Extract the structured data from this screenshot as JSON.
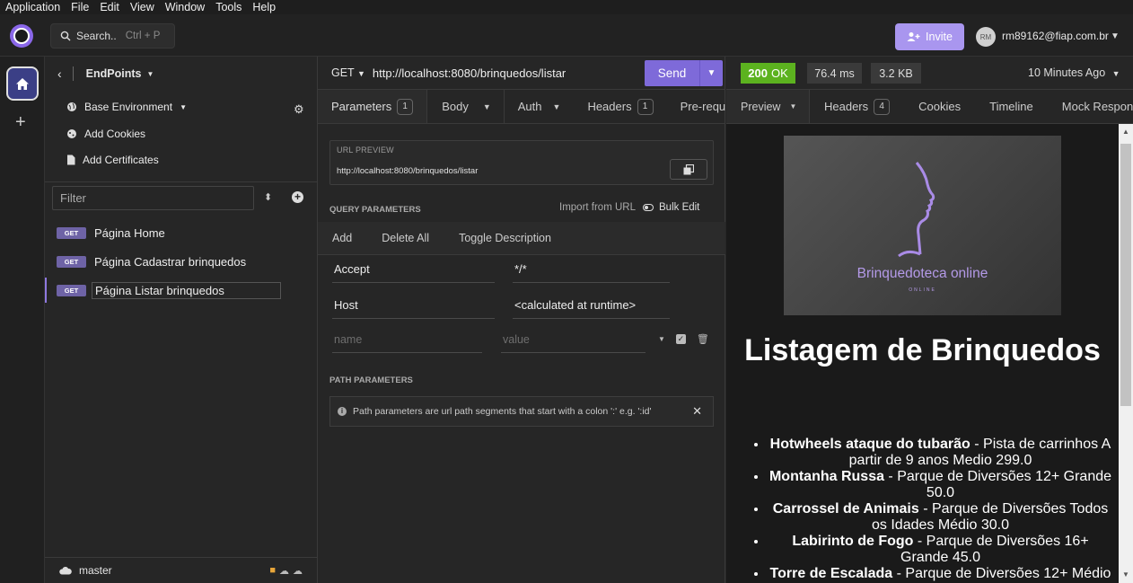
{
  "menu": [
    "Application",
    "File",
    "Edit",
    "View",
    "Window",
    "Tools",
    "Help"
  ],
  "topbar": {
    "search_label": "Search..",
    "search_shortcut": "Ctrl + P",
    "invite_label": "Invite",
    "avatar_initials": "RM",
    "account_email": "rm89162@fiap.com.br"
  },
  "sidebar": {
    "project_name": "EndPoints",
    "environment": "Base Environment",
    "add_cookies": "Add Cookies",
    "add_certificates": "Add Certificates",
    "filter_placeholder": "Filter",
    "requests": [
      {
        "method": "GET",
        "name": "Página Home"
      },
      {
        "method": "GET",
        "name": "Página Cadastrar brinquedos"
      },
      {
        "method": "GET",
        "name": "Página Listar brinquedos"
      }
    ],
    "branch": "master"
  },
  "request": {
    "method": "GET",
    "url": "http://localhost:8080/brinquedos/listar",
    "send_label": "Send",
    "tabs": [
      {
        "label": "Parameters",
        "badge": "1"
      },
      {
        "label": "Body"
      },
      {
        "label": "Auth"
      },
      {
        "label": "Headers",
        "badge": "1"
      },
      {
        "label": "Pre-requ"
      }
    ],
    "url_preview_title": "URL PREVIEW",
    "url_preview_value": "http://localhost:8080/brinquedos/listar",
    "query_title": "QUERY PARAMETERS",
    "import_from_url": "Import from URL",
    "bulk_edit": "Bulk Edit",
    "actions": [
      "Add",
      "Delete All",
      "Toggle Description"
    ],
    "params": [
      {
        "name": "Accept",
        "value": "*/*"
      },
      {
        "name": "Host",
        "value": "<calculated at runtime>"
      }
    ],
    "name_placeholder": "name",
    "value_placeholder": "value",
    "path_title": "PATH PARAMETERS",
    "path_info": "Path parameters are url path segments that start with a colon ':' e.g. ':id'"
  },
  "response": {
    "status_code": "200",
    "status_text": "OK",
    "time": "76.4 ms",
    "size": "3.2 KB",
    "when": "10 Minutes Ago",
    "tabs": [
      {
        "label": "Preview"
      },
      {
        "label": "Headers",
        "badge": "4"
      },
      {
        "label": "Cookies"
      },
      {
        "label": "Timeline"
      },
      {
        "label": "Mock Respons"
      }
    ],
    "banner_title": "Brinquedoteca online",
    "banner_sub": "ONLINE",
    "page_title": "Listagem de Brinquedos",
    "items": [
      {
        "name": "Hotwheels ataque do tubarão",
        "rest": " - Pista de carrinhos A partir de 9 anos Medio 299.0"
      },
      {
        "name": "Montanha Russa",
        "rest": " - Parque de Diversões 12+ Grande 50.0"
      },
      {
        "name": "Carrossel de Animais",
        "rest": " - Parque de Diversões Todos os Idades Médio 30.0"
      },
      {
        "name": "Labirinto de Fogo",
        "rest": " - Parque de Diversões 16+ Grande 45.0"
      },
      {
        "name": "Torre de Escalada",
        "rest": " - Parque de Diversões 12+ Médio"
      }
    ]
  }
}
